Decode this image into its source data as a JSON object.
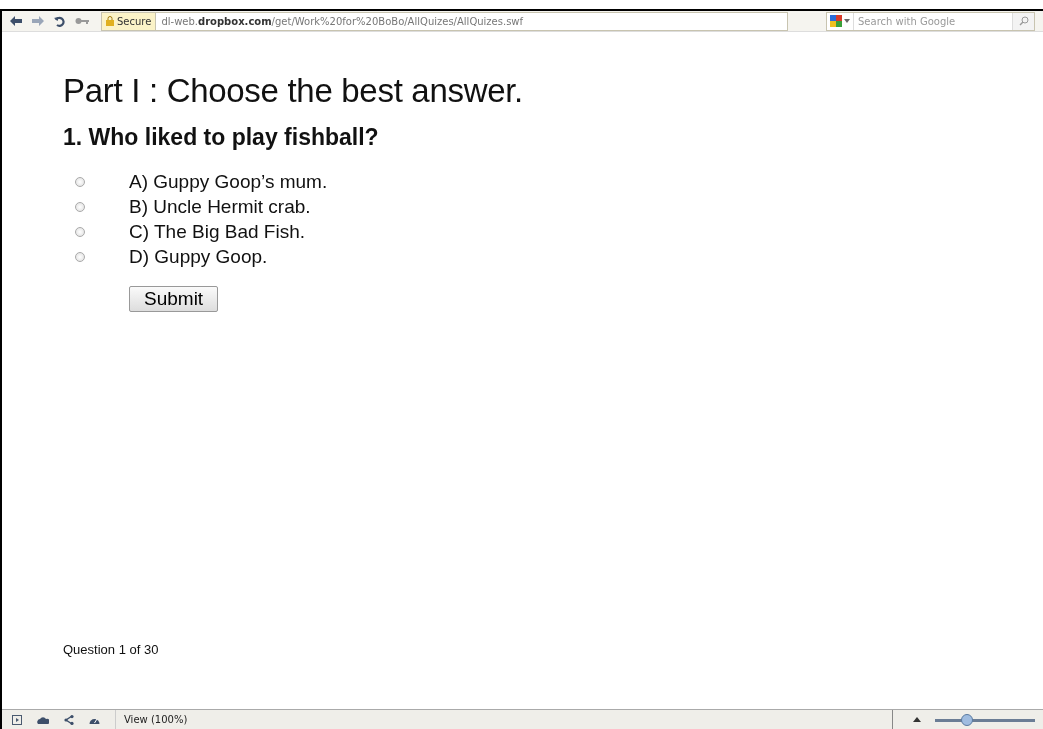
{
  "toolbar": {
    "secure_label": "Secure",
    "url": "dl-web.**dropbox.com**/get/Work%20for%20BoBo/AllQuizes/AllQuizes.swf",
    "search": {
      "placeholder": "Search with Google"
    }
  },
  "quiz": {
    "heading": "Part I : Choose the best answer.",
    "question": "1. Who liked to play fishball?",
    "options": [
      {
        "label": "A) Guppy Goop’s mum.",
        "selected": false
      },
      {
        "label": "B) Uncle Hermit crab.",
        "selected": false
      },
      {
        "label": "C) The Big Bad Fish.",
        "selected": false
      },
      {
        "label": "D) Guppy Goop.",
        "selected": false
      }
    ],
    "submit": "Submit",
    "progress": "Question 1 of 30"
  },
  "status_bar": {
    "view": "View (100%)",
    "zoom": {
      "level": 0.3
    }
  }
}
